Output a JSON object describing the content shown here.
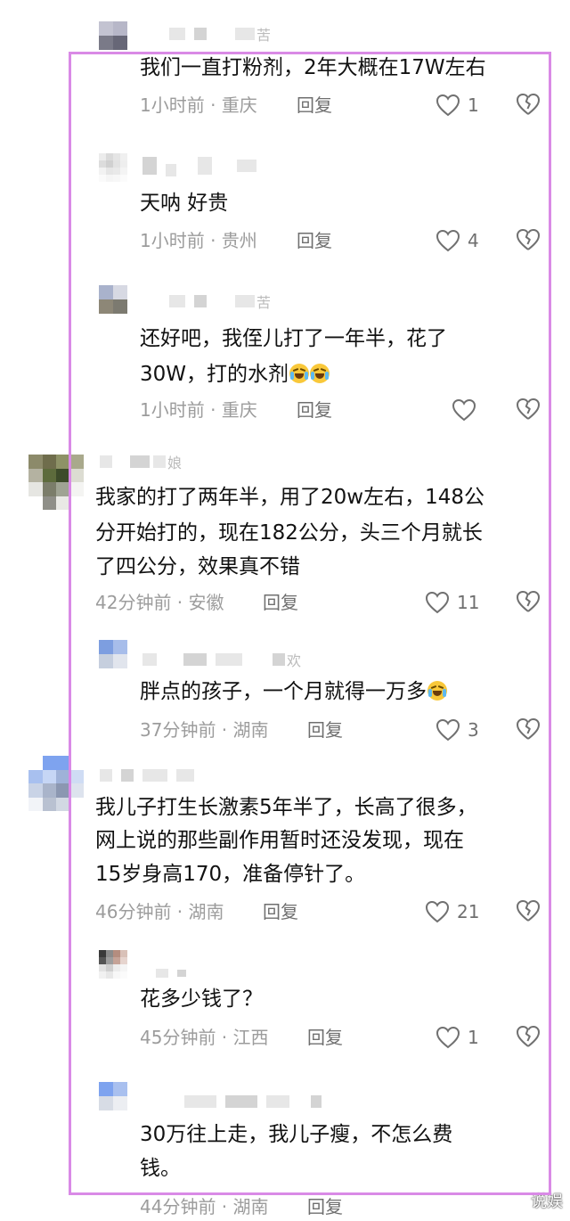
{
  "comments": [
    {
      "text": "我们一直打粉剂，2年大概在17W左右",
      "time_location": "1小时前 · 重庆",
      "reply": "回复",
      "likes": "1",
      "name_fragment": "苦"
    },
    {
      "text": "天呐 好贵",
      "time_location": "1小时前 · 贵州",
      "reply": "回复",
      "likes": "4"
    },
    {
      "text": "还好吧，我侄儿打了一年半，花了",
      "text2": "30W，打的水剂",
      "time_location": "1小时前 · 重庆",
      "reply": "回复",
      "likes": "",
      "name_fragment": "苦"
    },
    {
      "text": "我家的打了两年半，用了20w左右，148公",
      "text2": "分开始打的，现在182公分，头三个月就长",
      "text3": "了四公分，效果真不错",
      "time_location": "42分钟前 · 安徽",
      "reply": "回复",
      "likes": "11",
      "name_fragment": "娘"
    },
    {
      "text": "胖点的孩子，一个月就得一万多",
      "time_location": "37分钟前 · 湖南",
      "reply": "回复",
      "likes": "3",
      "name_fragment": "欢"
    },
    {
      "text": "我儿子打生长激素5年半了，长高了很多，",
      "text2": "网上说的那些副作用暂时还没发现，现在",
      "text3": "15岁身高170，准备停针了。",
      "time_location": "46分钟前 · 湖南",
      "reply": "回复",
      "likes": "21"
    },
    {
      "text": "花多少钱了？",
      "time_location": "45分钟前 · 江西",
      "reply": "回复",
      "likes": "1"
    },
    {
      "text": "30万往上走，我儿子瘦，不怎么费",
      "text2": "钱。",
      "time_location": "44分钟前 · 湖南",
      "reply": "回复",
      "likes": ""
    }
  ],
  "watermark": "说娱",
  "colors": {
    "frame": "#d98ae6",
    "meta": "#9c9c9c",
    "text": "#111111"
  }
}
